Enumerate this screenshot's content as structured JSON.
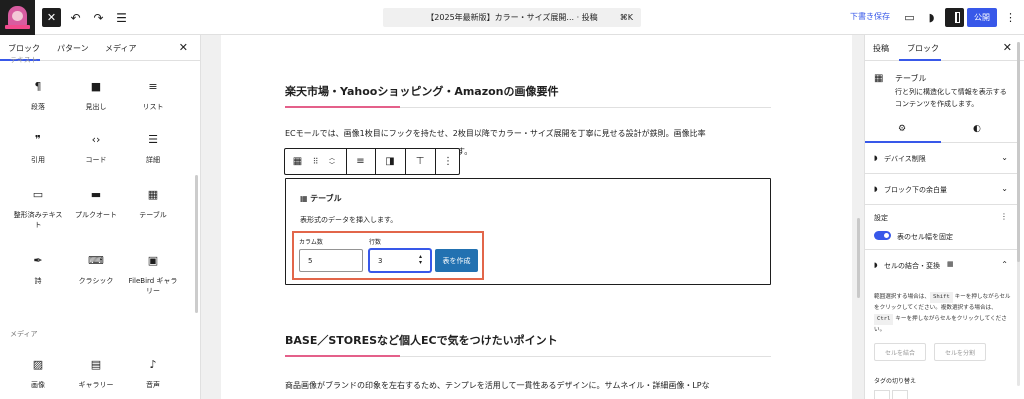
{
  "topbar": {
    "doc_title": "【2025年最新版】カラー・サイズ展開... · 投稿",
    "shortcut": "⌘K",
    "save_draft": "下書き保存",
    "publish": "公開",
    "accent_color": "#3858e9"
  },
  "left_panel": {
    "tabs": [
      "ブロック",
      "パターン",
      "メディア"
    ],
    "section_text": "テキスト",
    "section_media": "メディア",
    "blocks": [
      {
        "label": "段落",
        "icon": "paragraph-icon",
        "glyph": "¶"
      },
      {
        "label": "見出し",
        "icon": "bookmark-icon",
        "glyph": "■"
      },
      {
        "label": "リスト",
        "icon": "list-icon",
        "glyph": "≡"
      },
      {
        "label": "引用",
        "icon": "quote-icon",
        "glyph": "❞"
      },
      {
        "label": "コード",
        "icon": "code-icon",
        "glyph": "‹›"
      },
      {
        "label": "詳細",
        "icon": "details-icon",
        "glyph": "☰"
      },
      {
        "label": "整形済みテキスト",
        "icon": "preformatted-icon",
        "glyph": "▭"
      },
      {
        "label": "プルクオート",
        "icon": "pullquote-icon",
        "glyph": "▬"
      },
      {
        "label": "テーブル",
        "icon": "table-icon",
        "glyph": "▦"
      },
      {
        "label": "詩",
        "icon": "verse-icon",
        "glyph": "✒"
      },
      {
        "label": "クラシック",
        "icon": "keyboard-icon",
        "glyph": "⌨"
      },
      {
        "label": "FileBird ギャラリー",
        "icon": "gallery-icon",
        "glyph": "▣"
      },
      {
        "label": "画像",
        "icon": "image-icon",
        "glyph": "▨"
      },
      {
        "label": "ギャラリー",
        "icon": "gallery-icon",
        "glyph": "▤"
      },
      {
        "label": "音声",
        "icon": "audio-icon",
        "glyph": "♪"
      }
    ]
  },
  "content": {
    "heading1": "楽天市場・Yahooショッピング・Amazonの画像要件",
    "paragraph1_line1": "ECモールでは、画像1枚目にフックを持たせ、2枚目以降でカラー・サイズ展開を丁寧に見せる設計が鉄則。画像比率",
    "paragraph1_line2_tail": "す。",
    "table_block": {
      "title": "テーブル",
      "description": "表形式のデータを挿入します。",
      "columns_label": "カラム数",
      "columns_value": "5",
      "rows_label": "行数",
      "rows_value": "3",
      "create_button": "表を作成"
    },
    "heading2": "BASE／STORESなど個人ECで気をつけたいポイント",
    "paragraph2": "商品画像がブランドの印象を左右するため、テンプレを活用して一貫性あるデザインに。サムネイル・詳細画像・LPな"
  },
  "right_panel": {
    "tabs": [
      "投稿",
      "ブロック"
    ],
    "block_name": "テーブル",
    "block_desc": "行と列に構造化して情報を表示するコンテンツを作成します。",
    "device_limit": "デバイス制限",
    "margin_below": "ブロック下の余白量",
    "settings": "設定",
    "fixed_width": "表のセル幅を固定",
    "merge_section": "セルの結合・変換",
    "help_text_1": "範囲選択する場合は、",
    "help_key_1": "Shift",
    "help_text_2": " キーを押しながらセルをクリックしてください。複数選択する場合は、",
    "help_key_2": "Ctrl",
    "help_text_3": " キーを押しながらセルをクリックしてください。",
    "merge_button": "セルを結合",
    "split_button": "セルを分割",
    "tag_switch": "タグの切り替え"
  }
}
